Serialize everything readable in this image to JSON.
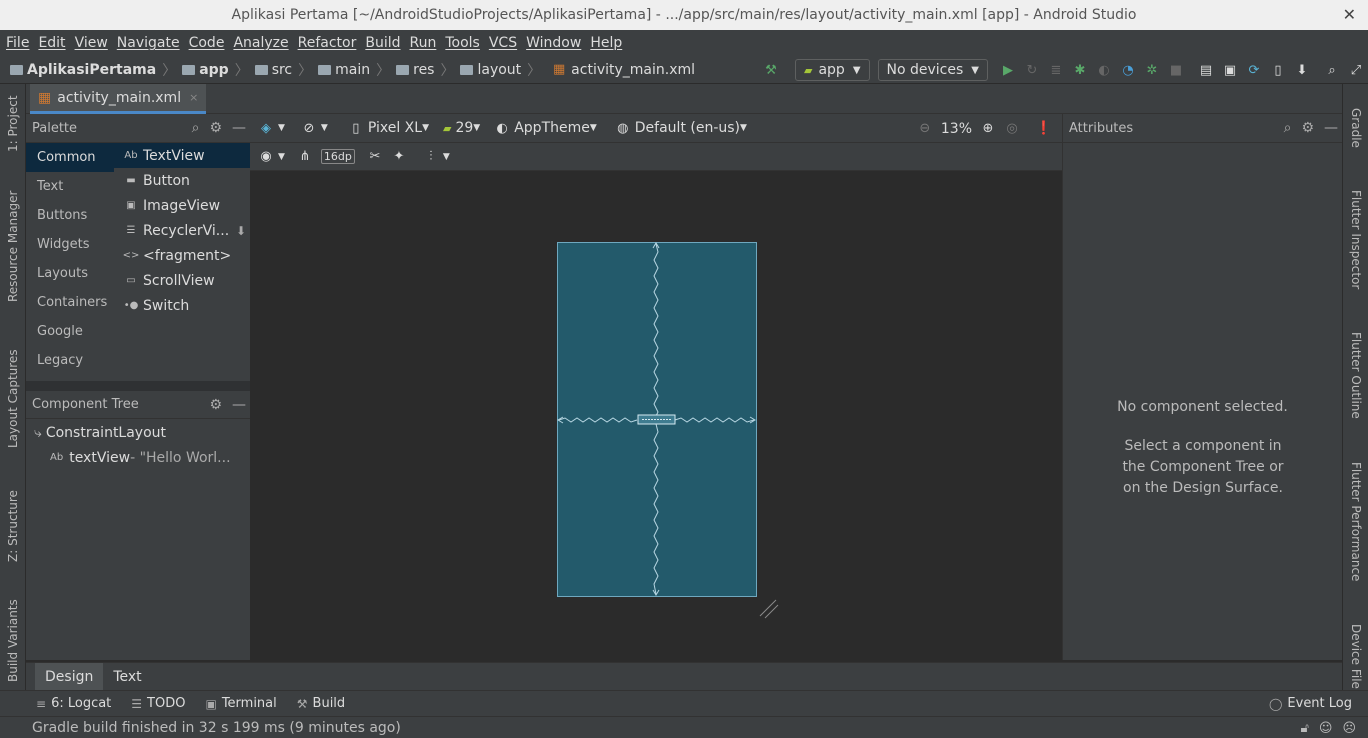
{
  "window": {
    "title": "Aplikasi Pertama [~/AndroidStudioProjects/AplikasiPertama] - .../app/src/main/res/layout/activity_main.xml [app] - Android Studio"
  },
  "menu": [
    "File",
    "Edit",
    "View",
    "Navigate",
    "Code",
    "Analyze",
    "Refactor",
    "Build",
    "Run",
    "Tools",
    "VCS",
    "Window",
    "Help"
  ],
  "breadcrumbs": [
    "AplikasiPertama",
    "app",
    "src",
    "main",
    "res",
    "layout",
    "activity_main.xml"
  ],
  "toolbar": {
    "run_config": "app",
    "device": "No devices"
  },
  "editor_tab": {
    "label": "activity_main.xml",
    "close": "×"
  },
  "left_strip": [
    "1: Project",
    "Resource Manager",
    "Layout Captures",
    "Z: Structure",
    "Build Variants"
  ],
  "right_strip": [
    "Gradle",
    "Flutter Inspector",
    "Flutter Outline",
    "Flutter Performance",
    "Device File"
  ],
  "palette": {
    "title": "Palette",
    "categories": [
      "Common",
      "Text",
      "Buttons",
      "Widgets",
      "Layouts",
      "Containers",
      "Google",
      "Legacy"
    ],
    "items": [
      {
        "icon": "Ab",
        "label": "TextView"
      },
      {
        "icon": "▬",
        "label": "Button"
      },
      {
        "icon": "▣",
        "label": "ImageView"
      },
      {
        "icon": "☰",
        "label": "RecyclerVi..."
      },
      {
        "icon": "<>",
        "label": "<fragment>"
      },
      {
        "icon": "▭",
        "label": "ScrollView"
      },
      {
        "icon": "•●",
        "label": "Switch"
      }
    ]
  },
  "component_tree": {
    "title": "Component Tree",
    "root": "ConstraintLayout",
    "child_icon": "Ab",
    "child": "textView",
    "child_value": "- \"Hello Worl..."
  },
  "design_toolbar": {
    "device": "Pixel XL",
    "api": "29",
    "theme": "AppTheme",
    "locale": "Default (en-us)",
    "zoom": "13%",
    "margin": "16dp"
  },
  "attributes": {
    "title": "Attributes",
    "empty_title": "No component selected.",
    "empty_hint": "Select a component in the Component Tree or on the Design Surface."
  },
  "bottom_tabs": [
    "Design",
    "Text"
  ],
  "tool_windows": [
    {
      "icon": "≡",
      "label": "6: Logcat"
    },
    {
      "icon": "☰",
      "label": "TODO"
    },
    {
      "icon": "▣",
      "label": "Terminal"
    },
    {
      "icon": "⚒",
      "label": "Build"
    }
  ],
  "event_log": "Event Log",
  "status": "Gradle build finished in 32 s 199 ms (9 minutes ago)",
  "colors": {
    "accent": "#4a88c7",
    "selection": "#0d293e",
    "blueprint": "#235a6b",
    "run": "#59a869",
    "debug": "#499c54"
  }
}
